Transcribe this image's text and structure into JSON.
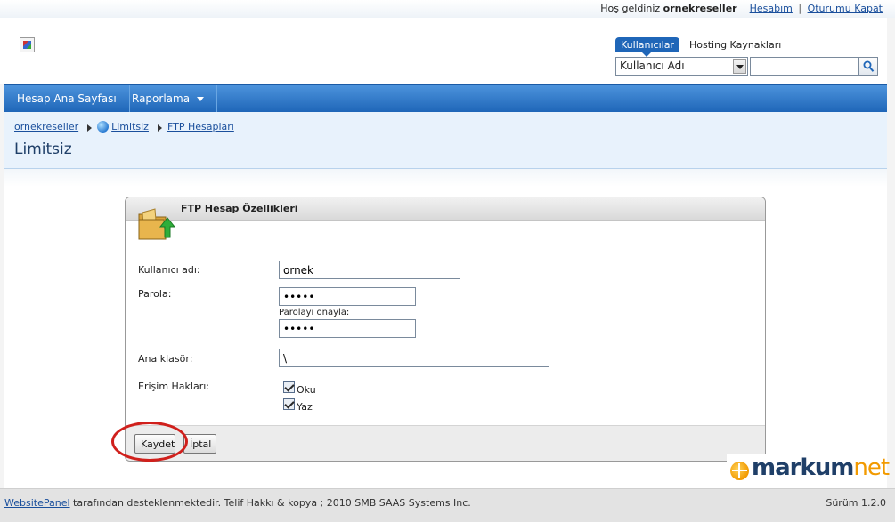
{
  "topbar": {
    "welcome": "Hoş geldiniz",
    "username": "ornekreseller",
    "account_link": "Hesabım",
    "separator": "|",
    "logout_link": "Oturumu Kapat"
  },
  "search": {
    "tab_active": "Kullanıcılar",
    "tab_inactive": "Hosting Kaynakları",
    "select_value": "Kullanıcı Adı",
    "input_value": ""
  },
  "nav": {
    "home": "Hesap Ana Sayfası",
    "reports": "Raporlama"
  },
  "breadcrumb": {
    "item1": "ornekreseller",
    "item2": "Limitsiz",
    "item3": "FTP Hesapları"
  },
  "page_title": "Limitsiz",
  "panel": {
    "title": "FTP Hesap Özellikleri",
    "username_label": "Kullanıcı adı:",
    "username_value": "ornek",
    "password_label": "Parola:",
    "password_value": "•••••",
    "confirm_label": "Parolayı onayla:",
    "confirm_value": "•••••",
    "folder_label": "Ana klasör:",
    "folder_value": "\\",
    "access_label": "Erişim Hakları:",
    "read_label": "Oku",
    "write_label": "Yaz",
    "read_checked": true,
    "write_checked": true,
    "save_button": "Kaydet",
    "cancel_button": "İptal"
  },
  "watermark": {
    "brand_main": "markum",
    "brand_suffix": "net"
  },
  "footer": {
    "link": "WebsitePanel",
    "text": " tarafından desteklenmektedir. Telif Hakkı & kopya ; 2010 SMB SAAS Systems Inc.",
    "version": "Sürüm 1.2.0"
  },
  "colors": {
    "accent": "#1f66b8",
    "nav_top": "#4c93dc",
    "breadcrumb_bg": "#e8f2fc",
    "annotation": "#d0201c",
    "watermark_orange": "#f29a00"
  },
  "icons": [
    "app-logo-icon",
    "search-icon",
    "dropdown-arrow-icon",
    "globe-icon",
    "breadcrumb-arrow-icon",
    "folder-upload-icon",
    "checkbox-icon"
  ]
}
